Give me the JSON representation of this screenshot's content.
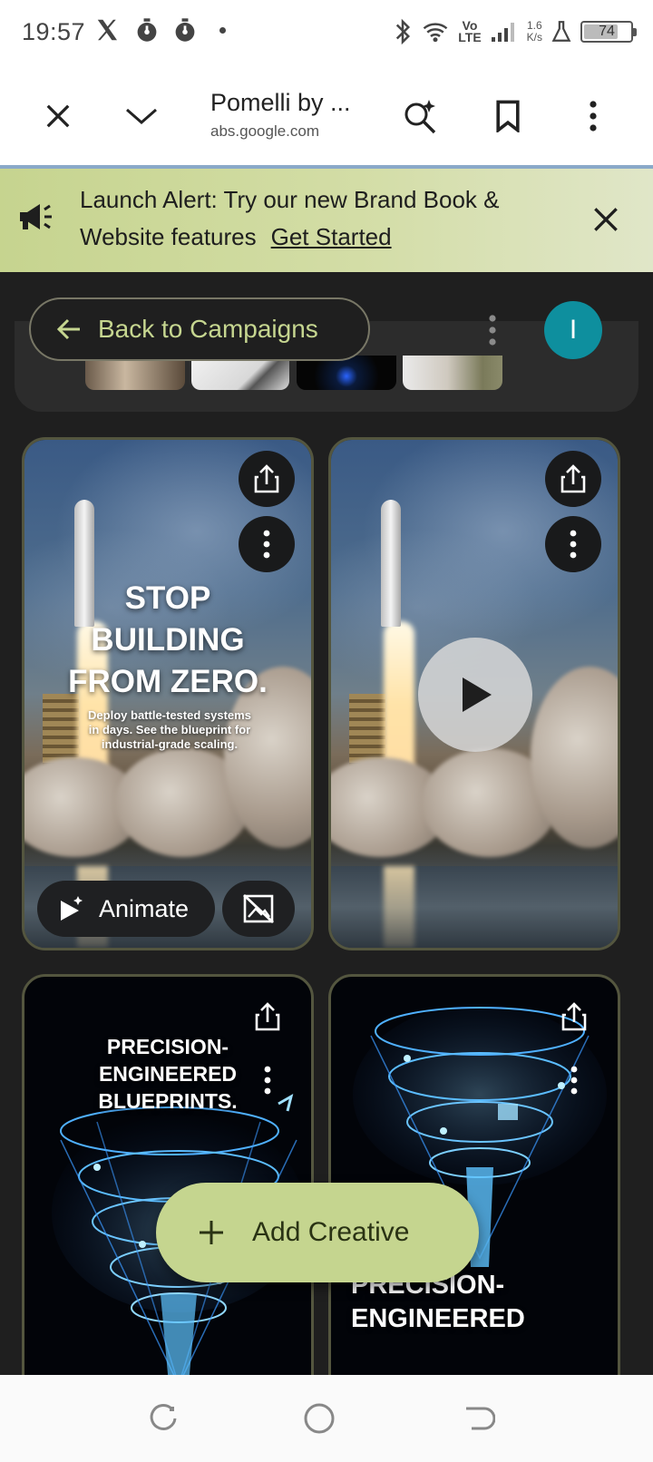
{
  "status_bar": {
    "time": "19:57",
    "network_speed_value": "1.6",
    "network_speed_unit": "K/s",
    "battery": "74",
    "battery_level": 0.74,
    "signal_label_top": "Vo",
    "signal_label_bottom": "LTE"
  },
  "browser": {
    "title": "Pomelli by ...",
    "url": "abs.google.com",
    "icons": [
      "close-icon",
      "chevron-down-icon",
      "search-sparkle-icon",
      "bookmark-icon",
      "more-vert-icon"
    ]
  },
  "banner": {
    "text": "Launch Alert: Try our new Brand Book & Website features",
    "link": "Get Started",
    "accent": "#c6d48f"
  },
  "header": {
    "back_label": "Back to Campaigns",
    "avatar_initial": "I",
    "avatar_color": "#0e8f9e"
  },
  "cards": [
    {
      "headline": "STOP BUILDING FROM ZERO.",
      "subtext": "Deploy battle-tested systems in days. See the blueprint for industrial-grade scaling.",
      "animate_label": "Animate"
    },
    {
      "type": "video"
    },
    {
      "headline": "PRECISION-ENGINEERED BLUEPRINTS."
    },
    {
      "headline": "PRECISION-ENGINEERED"
    }
  ],
  "fab": {
    "label": "Add Creative",
    "color": "#c5d58f"
  },
  "accent_colors": {
    "pill_text": "#c6d690",
    "border": "#54563f"
  }
}
